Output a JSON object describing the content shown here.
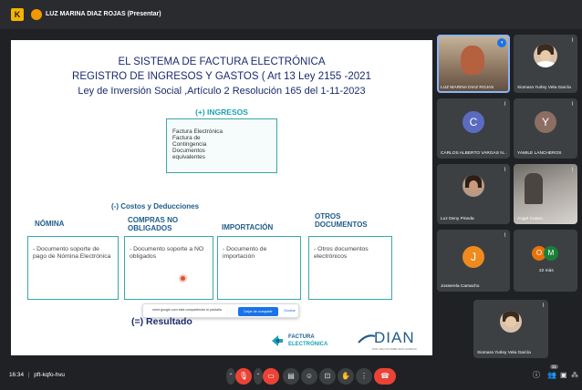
{
  "topbar": {
    "app_logo": "K",
    "presenter": "LUZ MARINA DIAZ ROJAS (Presentar)"
  },
  "slide": {
    "title_line1": "EL SISTEMA DE FACTURA ELECTRÓNICA",
    "title_line2": "REGISTRO  DE INGRESOS Y GASTOS ( Art 13 Ley 2155 -2021",
    "title_line3": "Ley de Inversión Social ,Artículo 2 Resolución 165 del 1-11-2023",
    "ingresos_heading": "(+) INGRESOS",
    "ingresos_items": [
      "Factura Electrónica",
      "Factura de",
      "Contingencia",
      "Documentos",
      "equivalentes"
    ],
    "costos_heading": "(-) Costos y Deducciones",
    "columns": [
      {
        "heading": "NÓMINA",
        "body": "- Documento soporte de pago de Nómina Electrónica"
      },
      {
        "heading": "COMPRAS NO OBLIGADOS",
        "body": "- Documento soporte a NO obligados"
      },
      {
        "heading": "IMPORTACIÓN",
        "body": "- Documento de importación"
      },
      {
        "heading": "OTROS DOCUMENTOS",
        "body": "- Otros documentos electrónicos"
      }
    ],
    "resultado": "(=) Resultado",
    "logo_factura_line1": "FACTURA",
    "logo_factura_line2": "ELECTRÓNICA",
    "logo_dian": "DIAN",
    "logo_dian_tag": "POR UNA COLOMBIA MÁS HONESTA"
  },
  "share_notice": {
    "message": "meet.google.com está compartiendo tu pantalla.",
    "stop_label": "Dejar de compartir",
    "hide_label": "Ocultar"
  },
  "participants": [
    {
      "name": "LUZ MARINA DIAZ ROJAS",
      "kind": "video"
    },
    {
      "name": "Xiomara Yurley Vela García",
      "kind": "photo"
    },
    {
      "name": "CARLOS ALBERTO VARGAS N...",
      "kind": "avatar",
      "initial": "C",
      "color": "#5c6bc0"
    },
    {
      "name": "YAMILE LANCHEROS",
      "kind": "avatar",
      "initial": "Y",
      "color": "#8d6e63"
    },
    {
      "name": "Luz Deny Pineda",
      "kind": "photo"
    },
    {
      "name": "Angel Cepeo",
      "kind": "video"
    },
    {
      "name": "Josserela Camacho",
      "kind": "avatar",
      "initial": "J",
      "color": "#ef8a1f"
    },
    {
      "name": "22 más",
      "kind": "group",
      "initials": [
        "O",
        "M"
      ],
      "colors": [
        "#e8710a",
        "#188038"
      ]
    },
    {
      "name": "Xiomara Yurley Vela García",
      "kind": "photo"
    }
  ],
  "bottombar": {
    "time": "16:34",
    "separator": "|",
    "meeting_code": "pft-kqfo-hvu",
    "people_badge": "31"
  },
  "colors": {
    "slide_heading": "#1a2b6d",
    "accent_teal": "#19a3b6",
    "end_call": "#ea4335"
  }
}
